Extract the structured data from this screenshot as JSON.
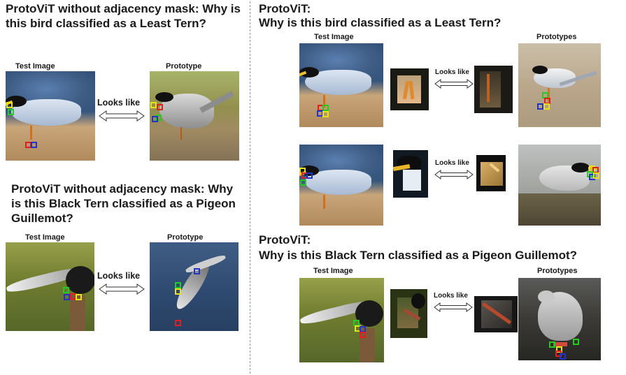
{
  "left": {
    "panel1": {
      "title": "ProtoViT without adjacency mask: Why is this bird classified as a Least Tern?",
      "test_label": "Test Image",
      "proto_label": "Prototype",
      "looks_like": "Looks like"
    },
    "panel2": {
      "title": "ProtoViT without adjacency mask: Why is this Black Tern classified as a Pigeon Guillemot?",
      "test_label": "Test Image",
      "proto_label": "Prototype",
      "looks_like": "Looks like"
    }
  },
  "right": {
    "panel1": {
      "title_line1": "ProtoViT:",
      "title_line2": "Why is this bird classified as a Least Tern?",
      "test_label": "Test Image",
      "proto_label": "Prototypes",
      "looks_like_1": "Looks like",
      "looks_like_2": "Looks like"
    },
    "panel2": {
      "title_line1": "ProtoViT:",
      "title_line2": "Why is this Black Tern classified as  a Pigeon Guillemot?",
      "test_label": "Test Image",
      "proto_label": "Prototypes",
      "looks_like": "Looks like"
    }
  },
  "colors": {
    "box_red": "#e0201e",
    "box_green": "#22cc22",
    "box_blue": "#2233cc",
    "box_yellow": "#e8e21a"
  }
}
